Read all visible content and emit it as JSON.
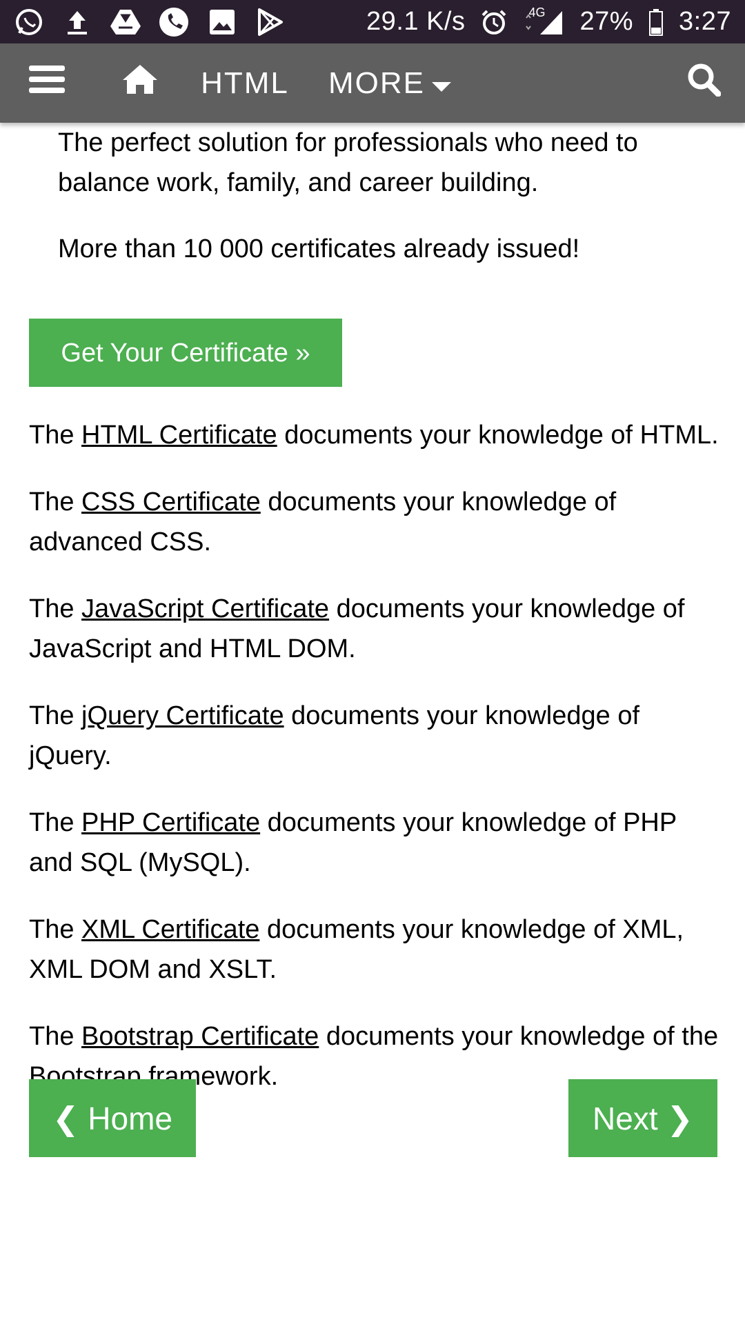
{
  "status_bar": {
    "net_speed": "29.1 K/s",
    "network": "4G",
    "battery": "27%",
    "time": "3:27",
    "icons": [
      "whatsapp-icon",
      "upload-icon",
      "drive-icon",
      "phone-icon",
      "image-icon",
      "play-store-icon",
      "alarm-icon",
      "signal-icon",
      "battery-icon"
    ]
  },
  "nav": {
    "html_label": "HTML",
    "more_label": "MORE",
    "icons": [
      "menu-icon",
      "home-icon",
      "caret-down-icon",
      "search-icon"
    ]
  },
  "intro": {
    "line1": "The perfect solution for professionals who need to balance work, family, and career building.",
    "line2": "More than 10 000 certificates already issued!"
  },
  "certificate_button": "Get Your Certificate »",
  "certificates": [
    {
      "prefix": "The ",
      "link": "HTML Certificate",
      "suffix": " documents your knowledge of HTML."
    },
    {
      "prefix": "The ",
      "link": "CSS Certificate",
      "suffix": " documents your knowledge of advanced CSS."
    },
    {
      "prefix": "The ",
      "link": "JavaScript Certificate",
      "suffix": " documents your knowledge of JavaScript and HTML DOM."
    },
    {
      "prefix": "The ",
      "link": "jQuery Certificate",
      "suffix": " documents your knowledge of jQuery."
    },
    {
      "prefix": "The ",
      "link": "PHP Certificate",
      "suffix": " documents your knowledge of PHP and SQL (MySQL)."
    },
    {
      "prefix": "The ",
      "link": "XML Certificate",
      "suffix": " documents your knowledge of XML, XML DOM and XSLT."
    },
    {
      "prefix": "The ",
      "link": "Bootstrap Certificate",
      "suffix": " documents your knowledge of the Bootstrap framework."
    }
  ],
  "buttons": {
    "home": "❮ Home",
    "next": "Next ❯"
  },
  "colors": {
    "accent_green": "#4caf50",
    "nav_gray": "#5f5f5f",
    "status_bar": "#2a1f2e"
  }
}
